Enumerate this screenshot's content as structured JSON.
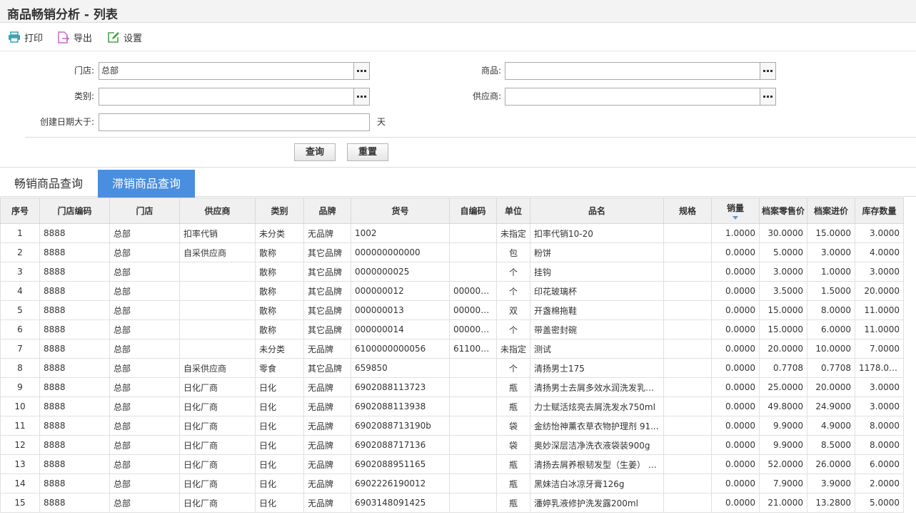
{
  "window": {
    "title": "商品畅销分析 - 列表"
  },
  "toolbar": {
    "print_label": "打印",
    "export_label": "导出",
    "settings_label": "设置"
  },
  "form": {
    "store_label": "门店:",
    "store_value": "总部",
    "product_label": "商品:",
    "product_value": "",
    "category_label": "类别:",
    "category_value": "",
    "supplier_label": "供应商:",
    "supplier_value": "",
    "created_after_label": "创建日期大于:",
    "created_after_value": "",
    "days_unit": "天",
    "query_button": "查询",
    "reset_button": "重置"
  },
  "tabs": [
    {
      "label": "畅销商品查询",
      "active": false
    },
    {
      "label": "滞销商品查询",
      "active": true
    }
  ],
  "table": {
    "columns": [
      "序号",
      "门店编码",
      "门店",
      "供应商",
      "类别",
      "品牌",
      "货号",
      "自编码",
      "单位",
      "品名",
      "规格",
      "销量",
      "档案零售价",
      "档案进价",
      "库存数量"
    ],
    "rows": [
      [
        "1",
        "8888",
        "总部",
        "扣率代销",
        "未分类",
        "无品牌",
        "1002",
        "",
        "未指定",
        "扣率代销10-20",
        "",
        "1.0000",
        "30.0000",
        "15.0000",
        "3.0000"
      ],
      [
        "2",
        "8888",
        "总部",
        "自采供应商",
        "散称",
        "其它品牌",
        "000000000000",
        "",
        "包",
        "粉饼",
        "",
        "0.0000",
        "5.0000",
        "3.0000",
        "4.0000"
      ],
      [
        "3",
        "8888",
        "总部",
        "",
        "散称",
        "其它品牌",
        "0000000025",
        "",
        "个",
        "挂钩",
        "",
        "0.0000",
        "3.0000",
        "1.0000",
        "3.0000"
      ],
      [
        "4",
        "8888",
        "总部",
        "",
        "散称",
        "其它品牌",
        "000000012",
        "000000...",
        "个",
        "印花玻璃杯",
        "",
        "0.0000",
        "3.5000",
        "1.5000",
        "20.0000"
      ],
      [
        "5",
        "8888",
        "总部",
        "",
        "散称",
        "其它品牌",
        "000000013",
        "000000...",
        "双",
        "开盏棉拖鞋",
        "",
        "0.0000",
        "15.0000",
        "8.0000",
        "11.0000"
      ],
      [
        "6",
        "8888",
        "总部",
        "",
        "散称",
        "其它品牌",
        "000000014",
        "000000...",
        "个",
        "带盖密封碗",
        "",
        "0.0000",
        "15.0000",
        "6.0000",
        "11.0000"
      ],
      [
        "7",
        "8888",
        "总部",
        "",
        "未分类",
        "无品牌",
        "6100000000056",
        "611000...",
        "未指定",
        "测试",
        "",
        "0.0000",
        "20.0000",
        "10.0000",
        "7.0000"
      ],
      [
        "8",
        "8888",
        "总部",
        "自采供应商",
        "零食",
        "其它品牌",
        "659850",
        "",
        "个",
        "清扬男士175",
        "",
        "0.0000",
        "0.7708",
        "0.7708",
        "1178.0000"
      ],
      [
        "9",
        "8888",
        "总部",
        "日化厂商",
        "日化",
        "无品牌",
        "6902088113723",
        "",
        "瓶",
        "清扬男士去屑多效水润洗发乳蓝...",
        "",
        "0.0000",
        "25.0000",
        "20.0000",
        "3.0000"
      ],
      [
        "10",
        "8888",
        "总部",
        "日化厂商",
        "日化",
        "无品牌",
        "6902088113938",
        "",
        "瓶",
        "力士赋活炫亮去屑洗发水750ml",
        "",
        "0.0000",
        "49.8000",
        "24.9000",
        "3.0000"
      ],
      [
        "11",
        "8888",
        "总部",
        "日化厂商",
        "日化",
        "无品牌",
        "6902088713190b",
        "",
        "袋",
        "金纺怡神薰衣草衣物护理剂 91...",
        "",
        "0.0000",
        "9.9000",
        "4.9000",
        "8.0000"
      ],
      [
        "12",
        "8888",
        "总部",
        "日化厂商",
        "日化",
        "无品牌",
        "6902088717136",
        "",
        "袋",
        "奥妙深层洁净洗衣液袋装900g",
        "",
        "0.0000",
        "9.9000",
        "8.5000",
        "8.0000"
      ],
      [
        "13",
        "8888",
        "总部",
        "日化厂商",
        "日化",
        "无品牌",
        "6902088951165",
        "",
        "瓶",
        "清扬去屑养根韧发型（生姜） 5...",
        "",
        "0.0000",
        "52.0000",
        "26.0000",
        "6.0000"
      ],
      [
        "14",
        "8888",
        "总部",
        "日化厂商",
        "日化",
        "无品牌",
        "6902226190012",
        "",
        "瓶",
        "黑妹洁白冰凉牙膏126g",
        "",
        "0.0000",
        "7.9000",
        "3.9000",
        "2.0000"
      ],
      [
        "15",
        "8888",
        "总部",
        "日化厂商",
        "日化",
        "无品牌",
        "6903148091425",
        "",
        "瓶",
        "潘婷乳液修护洗发露200ml",
        "",
        "0.0000",
        "21.0000",
        "13.2800",
        "5.0000"
      ]
    ]
  },
  "colors": {
    "active_tab": "#4a8ee0",
    "print_icon": "#3ba3b5",
    "export_icon": "#c86ac0",
    "settings_icon": "#4aa34a",
    "sort_indicator": "#5b9bd5"
  },
  "icons": {
    "print": "printer-icon",
    "export": "export-icon",
    "settings": "edit-settings-icon",
    "browse": "ellipsis-icon",
    "sort": "sort-desc-icon"
  }
}
